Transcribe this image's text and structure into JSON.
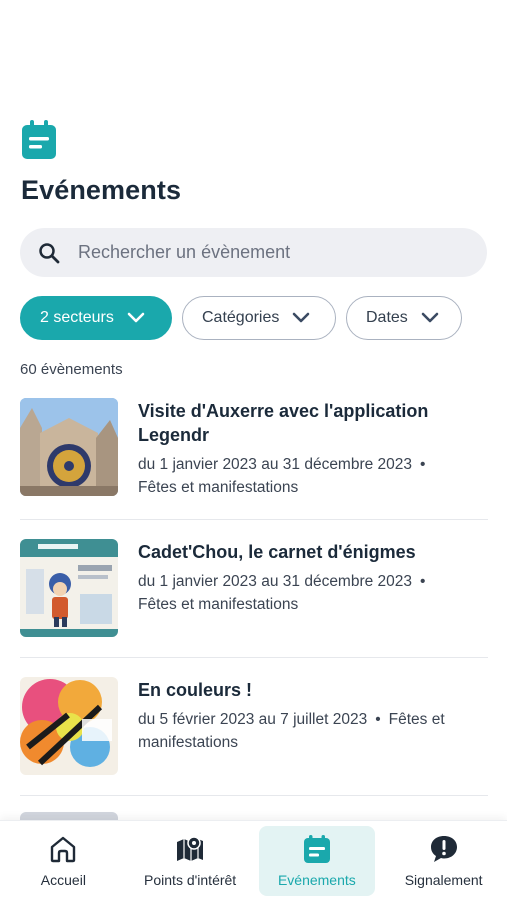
{
  "header": {
    "icon": "calendar-icon",
    "title": "Evénements"
  },
  "search": {
    "placeholder": "Rechercher un évènement"
  },
  "filters": [
    {
      "label": "2 secteurs",
      "active": true
    },
    {
      "label": "Catégories",
      "active": false
    },
    {
      "label": "Dates",
      "active": false
    }
  ],
  "results": {
    "count_label": "60 évènements"
  },
  "events": [
    {
      "title": "Visite d'Auxerre avec l'application Legendr",
      "dates": "du 1 janvier 2023 au 31 décembre 2023",
      "category": "Fêtes et manifestations"
    },
    {
      "title": "Cadet'Chou, le carnet d'énigmes",
      "dates": "du 1 janvier 2023 au 31 décembre 2023",
      "category": "Fêtes et manifestations"
    },
    {
      "title": "En couleurs !",
      "dates": "du 5 février 2023 au 7 juillet 2023",
      "category": "Fêtes et manifestations"
    }
  ],
  "tabs": [
    {
      "label": "Accueil",
      "icon": "home-icon",
      "active": false
    },
    {
      "label": "Points d'intérêt",
      "icon": "map-icon",
      "active": false
    },
    {
      "label": "Evénements",
      "icon": "calendar-icon",
      "active": true
    },
    {
      "label": "Signalement",
      "icon": "alert-bubble-icon",
      "active": false
    }
  ],
  "colors": {
    "accent": "#1aa8ac",
    "accent_light": "#e3f3f3",
    "text": "#1b2a3a"
  }
}
